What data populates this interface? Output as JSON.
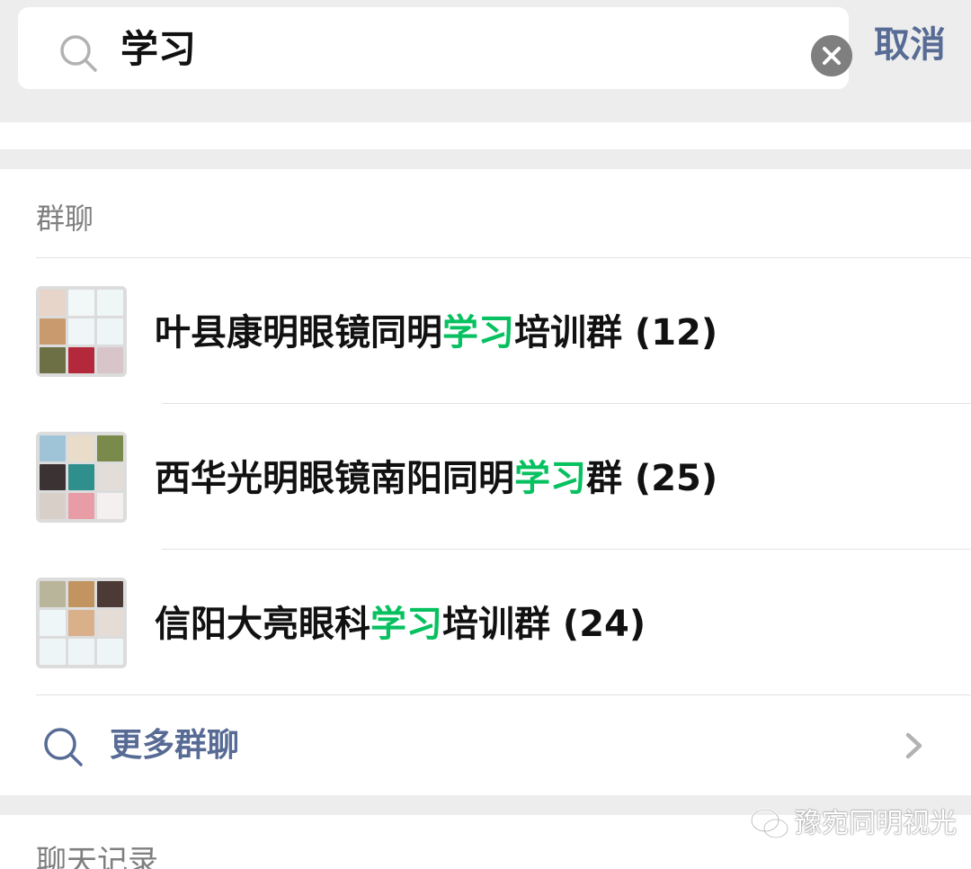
{
  "search": {
    "query": "学习",
    "cancel_label": "取消"
  },
  "group_section": {
    "title": "群聊",
    "items": [
      {
        "prefix": "叶县康明眼镜同明",
        "highlight": "学习",
        "suffix": "培训群 (12)"
      },
      {
        "prefix": "西华光明眼镜南阳同明",
        "highlight": "学习",
        "suffix": "群 (25)"
      },
      {
        "prefix": "信阳大亮眼科",
        "highlight": "学习",
        "suffix": "培训群 (24)"
      }
    ],
    "more_label": "更多群聊"
  },
  "chat_section": {
    "title": "聊天记录"
  },
  "watermark": {
    "text": "豫宛同明视光"
  },
  "colors": {
    "highlight": "#07c160",
    "link": "#576b95",
    "background": "#ededed"
  },
  "icons": [
    "search-icon",
    "clear-icon",
    "chevron-right-icon",
    "wechat-logo-icon"
  ]
}
